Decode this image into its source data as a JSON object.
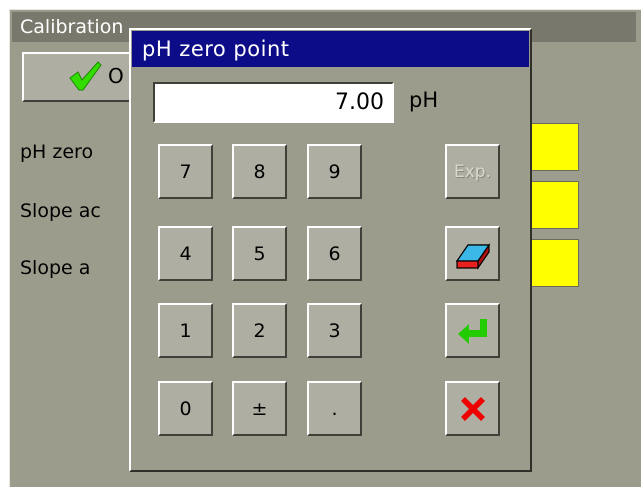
{
  "background_window": {
    "title": "Calibration",
    "ok_button": {
      "label": "O",
      "icon": "checkmark-icon",
      "icon_color": "#33dd00"
    },
    "rows": [
      {
        "label": "pH zero"
      },
      {
        "label": "Slope ac"
      },
      {
        "label": "Slope a"
      }
    ],
    "field_color": "#ffff00"
  },
  "dialog": {
    "title": "pH zero point",
    "display_value": "7.00",
    "unit": "pH",
    "keypad": [
      [
        "7",
        "8",
        "9"
      ],
      [
        "4",
        "5",
        "6"
      ],
      [
        "1",
        "2",
        "3"
      ],
      [
        "0",
        "±",
        "."
      ]
    ],
    "function_keys": {
      "exp_label": "Exp.",
      "exp_enabled": false,
      "clear_icon": "eraser-icon",
      "enter_icon": "enter-arrow-icon",
      "cancel_icon": "red-x-icon"
    }
  },
  "colors": {
    "panel": "#9c9c8c",
    "title_bar": "#0c0c88",
    "enter_arrow": "#22cc00",
    "cancel_x": "#ee0000"
  }
}
